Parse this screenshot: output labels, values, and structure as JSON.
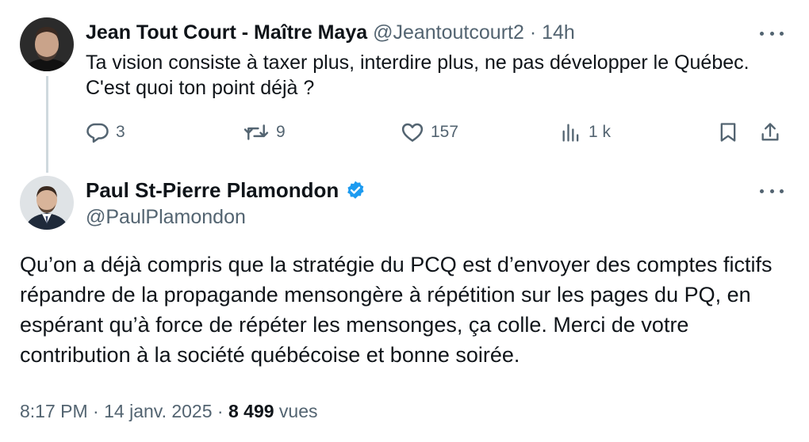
{
  "reply": {
    "author_name": "Jean Tout Court - Maître Maya",
    "handle": "@Jeantoutcourt2",
    "separator": "·",
    "time": "14h",
    "text": "Ta vision consiste à taxer plus, interdire plus, ne pas développer le Québec. C'est quoi ton point déjà ?",
    "actions": {
      "replies": "3",
      "reposts": "9",
      "likes": "157",
      "views": "1 k"
    }
  },
  "main_tweet": {
    "author_name": "Paul St-Pierre Plamondon",
    "handle": "@PaulPlamondon",
    "verified": true,
    "text": "Qu’on a déjà compris que la stratégie du PCQ est d’envoyer des comptes fictifs répandre de la propagande mensongère à répétition sur les pages du PQ, en espérant qu’à force de répéter les mensonges, ça colle. Merci de votre contribution à la société québécoise et bonne soirée.",
    "time": "8:17 PM",
    "sep1": "·",
    "date": "14 janv. 2025",
    "sep2": "·",
    "views_count": "8 499",
    "views_label": "vues"
  },
  "colors": {
    "text": "#0f1419",
    "secondary": "#536471",
    "verified": "#1d9bf0",
    "thread_line": "#cfd9de"
  },
  "icons": {
    "reply": "speech-bubble-icon",
    "repost": "repost-arrows-icon",
    "like": "heart-icon",
    "views": "bar-chart-icon",
    "bookmark": "bookmark-icon",
    "share": "share-icon",
    "more": "more-dots-icon",
    "verified": "verified-badge-icon"
  }
}
